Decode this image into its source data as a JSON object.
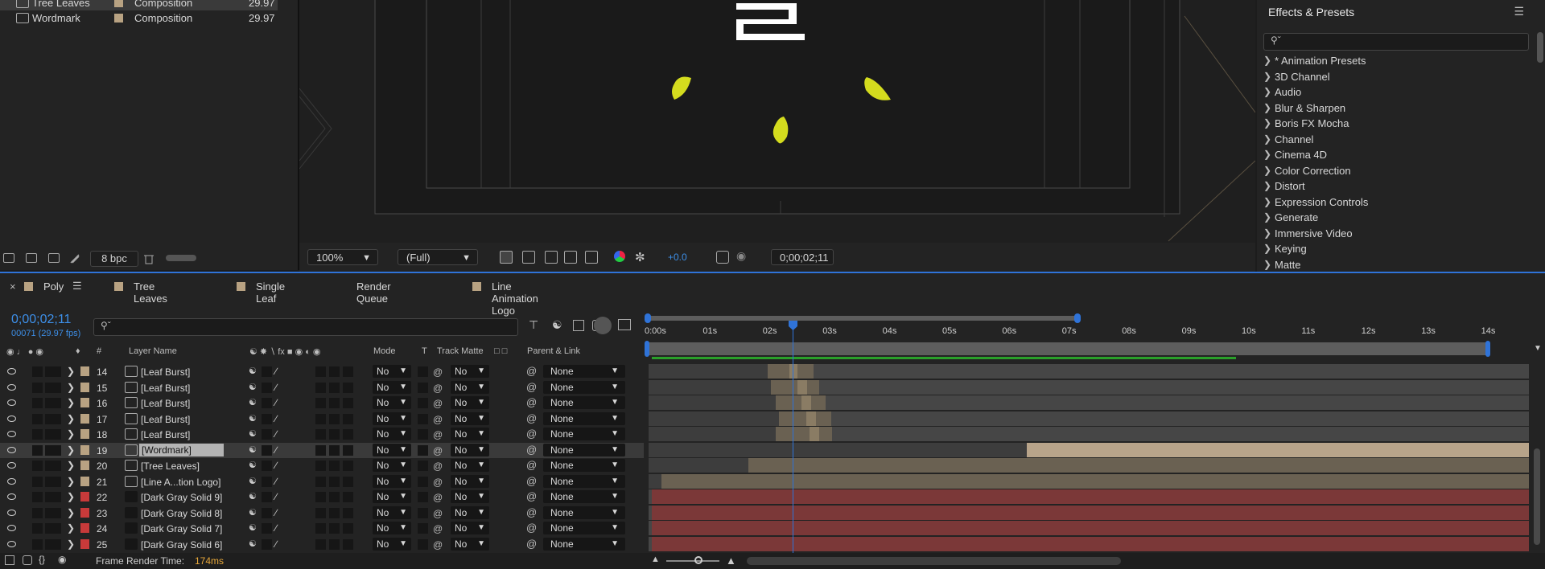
{
  "project": {
    "items": [
      {
        "name": "Tree Leaves",
        "type": "Composition",
        "fps": "29.97"
      },
      {
        "name": "Wordmark",
        "type": "Composition",
        "fps": "29.97"
      }
    ],
    "bpc": "8 bpc"
  },
  "viewer": {
    "zoom": "100%",
    "resolution": "(Full)",
    "exposure": "+0.0",
    "timecode": "0;00;02;11"
  },
  "effects": {
    "title": "Effects & Presets",
    "items": [
      "* Animation Presets",
      "3D Channel",
      "Audio",
      "Blur & Sharpen",
      "Boris FX Mocha",
      "Channel",
      "Cinema 4D",
      "Color Correction",
      "Distort",
      "Expression Controls",
      "Generate",
      "Immersive Video",
      "Keying",
      "Matte"
    ]
  },
  "timeline": {
    "tabs": [
      "Poly",
      "Tree Leaves",
      "Single Leaf",
      "Render Queue",
      "Line Animation Logo"
    ],
    "current_time": "0;00;02;11",
    "frame_info": "00071 (29.97 fps)",
    "columns": {
      "num": "#",
      "layer_name": "Layer Name",
      "mode": "Mode",
      "t": "T",
      "track_matte": "Track Matte",
      "parent": "Parent & Link"
    },
    "ruler": [
      "0:00s",
      "01s",
      "02s",
      "03s",
      "04s",
      "05s",
      "06s",
      "07s",
      "08s",
      "09s",
      "10s",
      "11s",
      "12s",
      "13s",
      "14s"
    ],
    "layers": [
      {
        "num": "14",
        "name": "[Leaf Burst]",
        "mode": "No",
        "matte": "No",
        "parent": "None",
        "color": "#b8a282"
      },
      {
        "num": "15",
        "name": "[Leaf Burst]",
        "mode": "No",
        "matte": "No",
        "parent": "None",
        "color": "#b8a282"
      },
      {
        "num": "16",
        "name": "[Leaf Burst]",
        "mode": "No",
        "matte": "No",
        "parent": "None",
        "color": "#b8a282"
      },
      {
        "num": "17",
        "name": "[Leaf Burst]",
        "mode": "No",
        "matte": "No",
        "parent": "None",
        "color": "#b8a282"
      },
      {
        "num": "18",
        "name": "[Leaf Burst]",
        "mode": "No",
        "matte": "No",
        "parent": "None",
        "color": "#b8a282"
      },
      {
        "num": "19",
        "name": "[Wordmark]",
        "mode": "No",
        "matte": "No",
        "parent": "None",
        "color": "#b8a282"
      },
      {
        "num": "20",
        "name": "[Tree Leaves]",
        "mode": "No",
        "matte": "No",
        "parent": "None",
        "color": "#b8a282"
      },
      {
        "num": "21",
        "name": "[Line A...tion Logo]",
        "mode": "No",
        "matte": "No",
        "parent": "None",
        "color": "#b8a282"
      },
      {
        "num": "22",
        "name": "[Dark Gray Solid 9]",
        "mode": "No",
        "matte": "No",
        "parent": "None",
        "color": "#c83a3a"
      },
      {
        "num": "23",
        "name": "[Dark Gray Solid 8]",
        "mode": "No",
        "matte": "No",
        "parent": "None",
        "color": "#c83a3a"
      },
      {
        "num": "24",
        "name": "[Dark Gray Solid 7]",
        "mode": "No",
        "matte": "No",
        "parent": "None",
        "color": "#c83a3a"
      },
      {
        "num": "25",
        "name": "[Dark Gray Solid 6]",
        "mode": "No",
        "matte": "No",
        "parent": "None",
        "color": "#c83a3a"
      }
    ],
    "frame_render_label": "Frame Render Time:",
    "frame_render_value": "174ms"
  }
}
